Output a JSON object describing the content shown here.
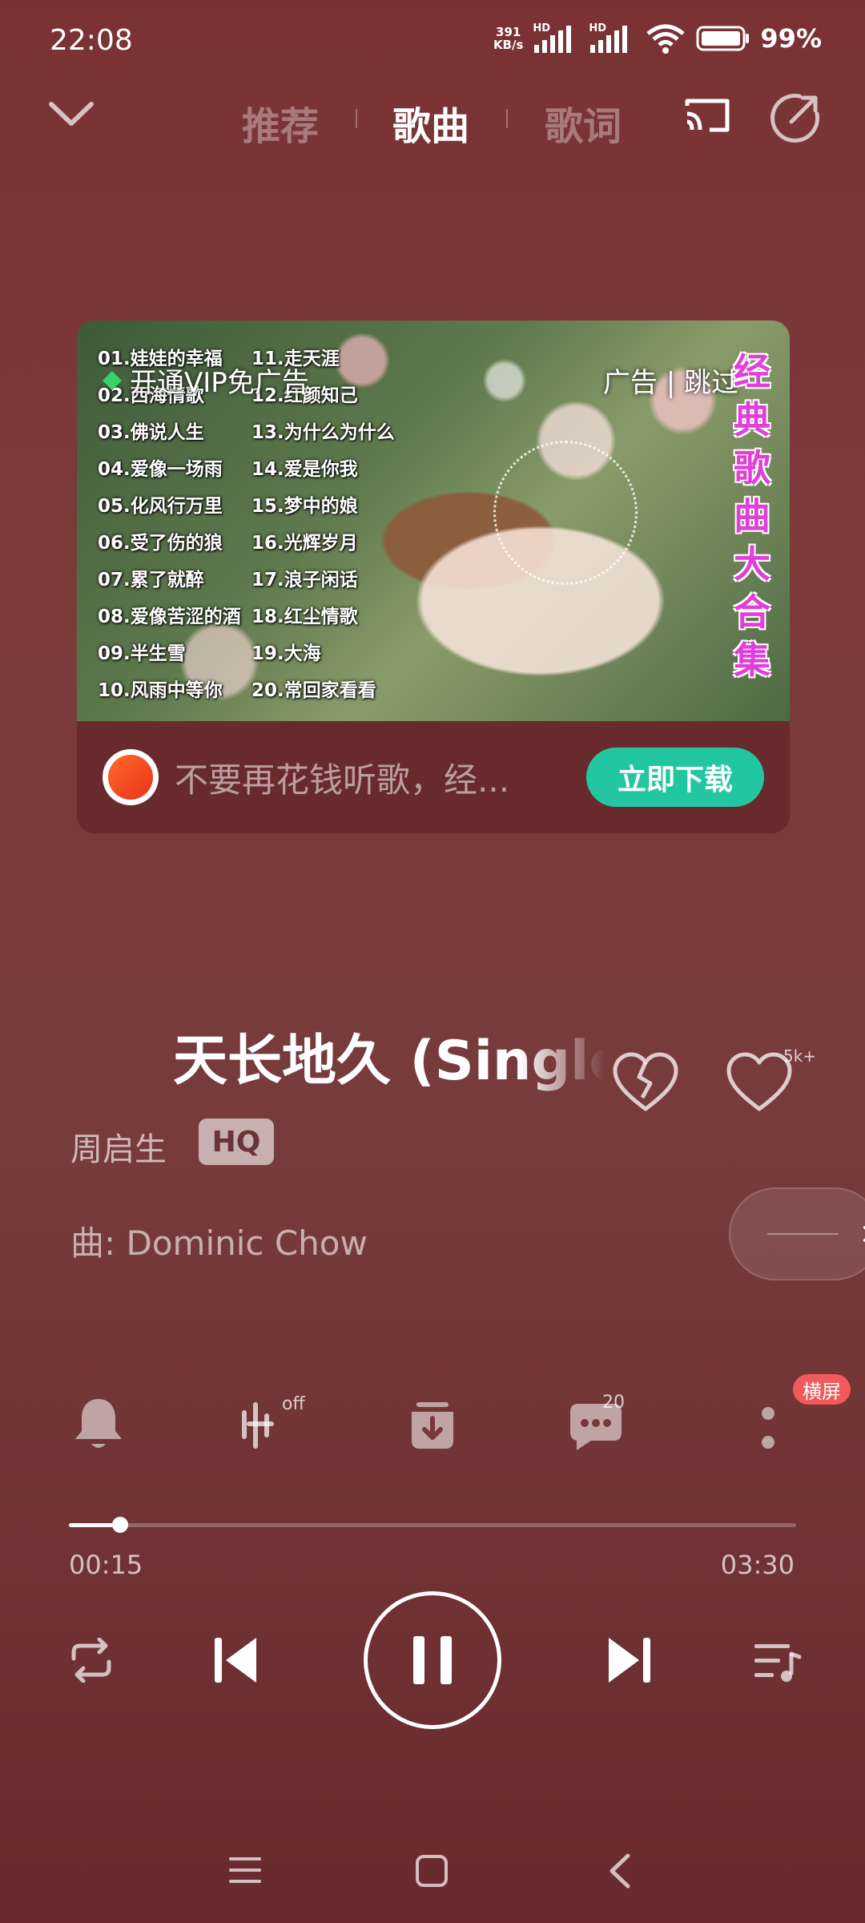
{
  "status_bar": {
    "time": "22:08",
    "net_speed_value": "391",
    "net_speed_unit": "KB/s",
    "signal_1_label": "HD",
    "signal_2_label": "HD",
    "battery": "99%"
  },
  "nav": {
    "tabs": [
      {
        "label": "推荐",
        "active": false
      },
      {
        "label": "歌曲",
        "active": true
      },
      {
        "label": "歌词",
        "active": false
      }
    ]
  },
  "ad": {
    "vip_text": "开通VIP免广告",
    "ad_label": "广告",
    "skip_label": "跳过",
    "skip_text": "广告 | 跳过",
    "vertical_title": "经典歌曲大合集",
    "playlist_left": [
      "01.娃娃的幸福",
      "02.西海情歌",
      "03.佛说人生",
      "04.爱像一场雨",
      "05.化风行万里",
      "06.受了伤的狼",
      "07.累了就醉",
      "08.爱像苦涩的酒",
      "09.半生雪",
      "10.风雨中等你"
    ],
    "playlist_right": [
      "11.走天涯",
      "12.红颜知己",
      "13.为什么为什么",
      "14.爱是你我",
      "15.梦中的娘",
      "16.光辉岁月",
      "17.浪子闲话",
      "18.红尘情歌",
      "19.大海",
      "20.常回家看看"
    ],
    "description": "不要再花钱听歌，经...",
    "download_label": "立即下载",
    "download_color": "#22c7a2"
  },
  "song": {
    "title": "天长地久 (Single",
    "artist": "周启生",
    "quality_badge": "HQ",
    "composer_line": "曲: Dominic Chow",
    "like_count": "5k+"
  },
  "tools": {
    "effect_state": "off",
    "comment_count": "20",
    "landscape_badge": "横屏",
    "badge_color": "#f05a5a"
  },
  "progress": {
    "current": "00:15",
    "total": "03:30",
    "fraction": 0.071
  },
  "controls": {
    "state": "playing"
  }
}
